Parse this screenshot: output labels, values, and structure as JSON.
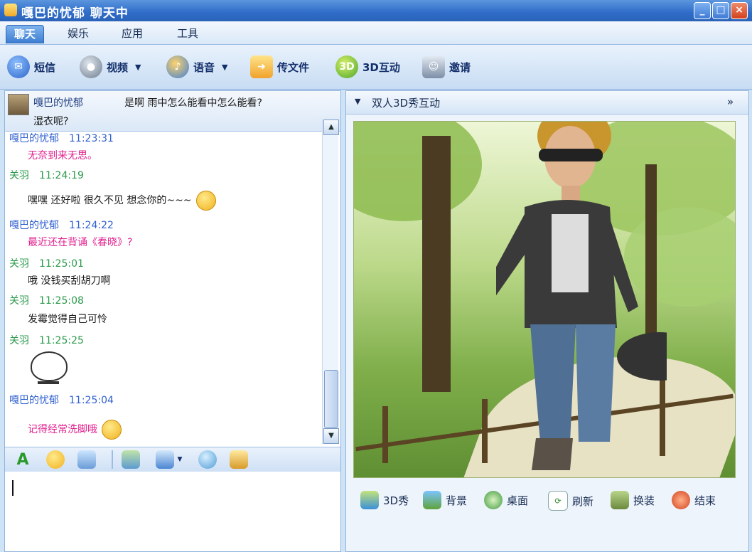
{
  "window": {
    "title": "嘎巴的忧郁 聊天中",
    "min_label": "_",
    "max_label": "□",
    "close_label": "×"
  },
  "menu": {
    "tabs": [
      {
        "label": "聊天",
        "active": true
      },
      {
        "label": "娱乐"
      },
      {
        "label": "应用"
      },
      {
        "label": "工具"
      }
    ]
  },
  "toolbar": {
    "items": [
      {
        "label": "短信",
        "icon": "sms-icon"
      },
      {
        "label": "视频",
        "icon": "video-icon",
        "dropdown": "▼"
      },
      {
        "label": "语音",
        "icon": "voice-icon",
        "dropdown": "▼"
      },
      {
        "label": "传文件",
        "icon": "file-transfer-icon"
      },
      {
        "label": "3D互动",
        "icon": "3d-icon",
        "badge": "3D"
      },
      {
        "label": "邀请",
        "icon": "invite-icon"
      }
    ]
  },
  "chat": {
    "header": {
      "sender": "嘎巴的忧郁",
      "line1": "是啊 雨中怎么能看中怎么能看?",
      "line2": "湿衣呢?"
    },
    "messages": [
      {
        "name": "嘎巴的忧郁",
        "time": "11:23:31",
        "text": "无奈到来无思。"
      },
      {
        "name": "关羽",
        "time": "11:24:19",
        "text": "嘿嘿 还好啦 很久不见 想念你的~~~"
      },
      {
        "name": "嘎巴的忧郁",
        "time": "11:24:22",
        "text": "最近还在背诵《春晓》?"
      },
      {
        "name": "关羽",
        "time": "11:25:01",
        "text": "哦 没钱买刮胡刀啊"
      },
      {
        "name": "关羽",
        "time": "11:25:08",
        "text": "发霉觉得自己可怜"
      },
      {
        "name": "关羽",
        "time": "11:25:25",
        "text": ""
      },
      {
        "name": "嘎巴的忧郁",
        "time": "11:25:04",
        "text": "记得经常洗脚哦"
      }
    ],
    "scroll_up": "▲",
    "scroll_down": "▼",
    "format_tools": [
      "font-icon",
      "emoji-icon",
      "shake-icon",
      "image-icon",
      "screenshot-icon",
      "voice-msg-icon",
      "more-icon"
    ]
  },
  "panel3d": {
    "title": "双人3D秀互动",
    "collapse_label": "▼",
    "expand_label": "»",
    "actions": [
      {
        "label": "3D秀",
        "icon": "3d-show-icon"
      },
      {
        "label": "背景",
        "icon": "background-icon"
      },
      {
        "label": "桌面",
        "icon": "desktop-icon"
      },
      {
        "label": "刷新",
        "icon": "refresh-icon"
      },
      {
        "label": "换装",
        "icon": "outfit-icon"
      },
      {
        "label": "结束",
        "icon": "end-icon"
      }
    ]
  },
  "colors": {
    "accent": "#2f6cc9",
    "name_blue": "#2f5fd0",
    "name_green": "#2b9a4a",
    "text_pink": "#e0208e"
  }
}
